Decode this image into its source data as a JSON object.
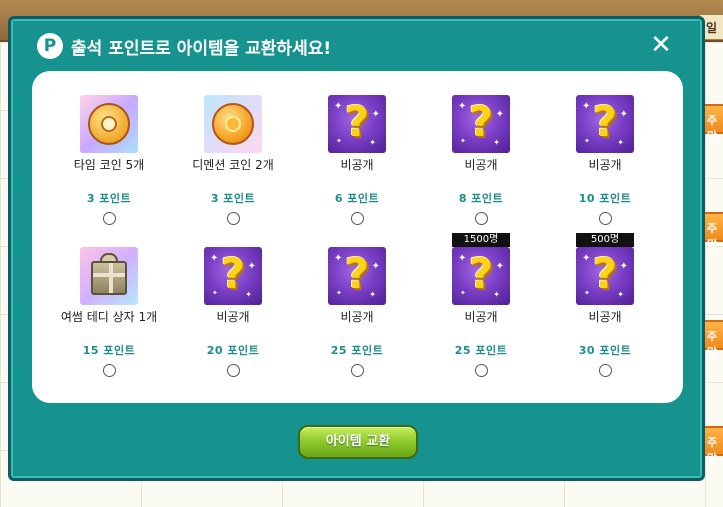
{
  "background": {
    "day_label": "일",
    "week_label": "주말"
  },
  "modal": {
    "title": "출석 포인트로 아이템을 교환하세요!",
    "logo_letter": "P",
    "close_symbol": "✕",
    "exchange_button": "아이템 교환"
  },
  "items": [
    {
      "name": "타임 코인 5개",
      "points": "3 포인트",
      "icon": "time-coin-icon",
      "badge": ""
    },
    {
      "name": "디멘션 코인 2개",
      "points": "3 포인트",
      "icon": "dimension-coin-icon",
      "badge": ""
    },
    {
      "name": "비공개",
      "points": "6 포인트",
      "icon": "mystery-icon",
      "badge": ""
    },
    {
      "name": "비공개",
      "points": "8 포인트",
      "icon": "mystery-icon",
      "badge": ""
    },
    {
      "name": "비공개",
      "points": "10 포인트",
      "icon": "mystery-icon",
      "badge": ""
    },
    {
      "name": "여썸 테디 상자 1개",
      "points": "15 포인트",
      "icon": "teddy-box-icon",
      "badge": ""
    },
    {
      "name": "비공개",
      "points": "20 포인트",
      "icon": "mystery-icon",
      "badge": ""
    },
    {
      "name": "비공개",
      "points": "25 포인트",
      "icon": "mystery-icon",
      "badge": ""
    },
    {
      "name": "비공개",
      "points": "25 포인트",
      "icon": "mystery-icon",
      "badge": "1500명"
    },
    {
      "name": "비공개",
      "points": "30 포인트",
      "icon": "mystery-icon",
      "badge": "500명"
    }
  ],
  "colors": {
    "modal_bg": "#17938f",
    "points_text": "#1d8e8a",
    "button_green": "#8cc92a"
  }
}
